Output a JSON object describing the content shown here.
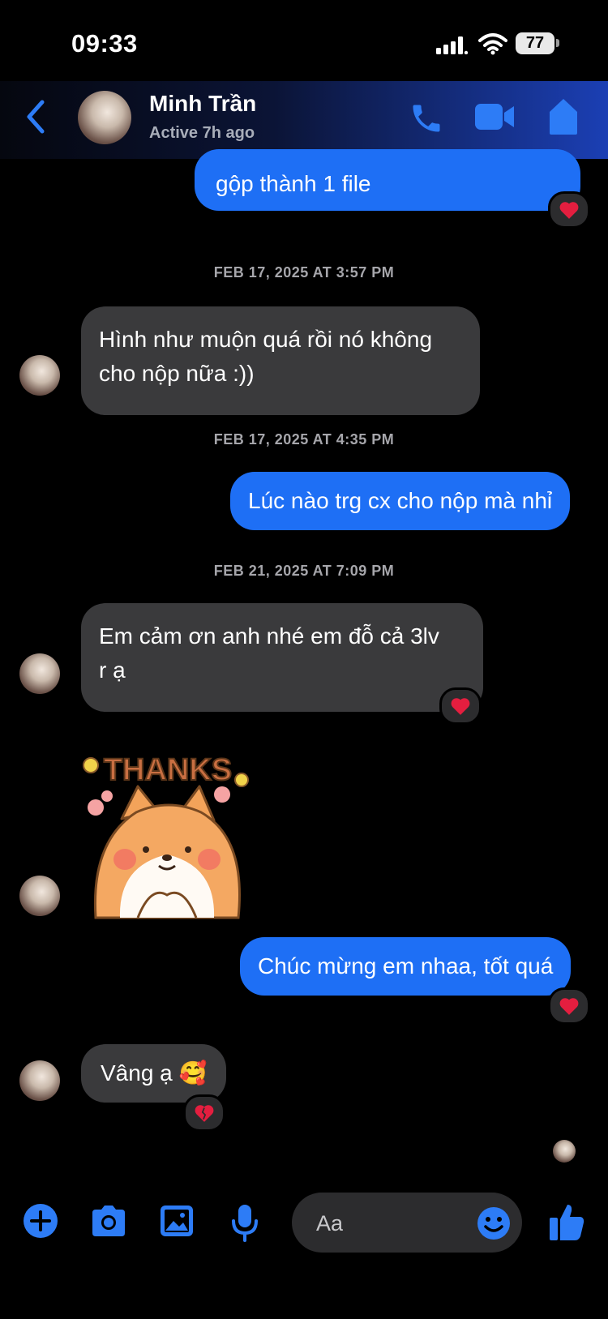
{
  "status": {
    "time": "09:33",
    "battery": "77"
  },
  "header": {
    "name": "Minh Trần",
    "status": "Active 7h ago"
  },
  "messages": {
    "m0": "gộp thành 1 file",
    "ts1": "FEB 17, 2025 AT 3:57 PM",
    "m1_line1": "Hình như muộn quá rồi nó không",
    "m1_line2": "cho nộp nữa :))",
    "ts2": "FEB 17, 2025 AT 4:35 PM",
    "m2": "Lúc nào trg cx cho nộp mà nhỉ",
    "ts3": "FEB 21, 2025 AT 7:09 PM",
    "m3_line1": "Em cảm ơn anh nhé em đỗ cả 3lv",
    "m3_line2": "r ạ",
    "sticker_text": "THANKS",
    "m4": "Chúc mừng em nhaa, tốt quá",
    "m5": "Vâng ạ 🥰"
  },
  "composer": {
    "placeholder": "Aa"
  },
  "colors": {
    "accent": "#1e6ff5",
    "incoming": "#3a3a3c",
    "icon": "#2d7cf6",
    "heart": "#e41e3f"
  }
}
